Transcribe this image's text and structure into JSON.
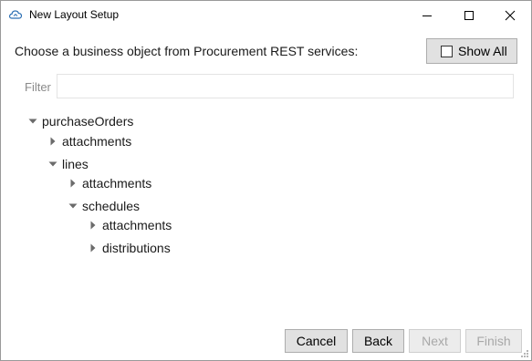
{
  "window": {
    "title": "New Layout Setup"
  },
  "prompt": "Choose a business object from Procurement REST services:",
  "show_all": {
    "label": "Show All",
    "checked": false
  },
  "filter": {
    "label": "Filter",
    "value": "",
    "placeholder": ""
  },
  "tree": [
    {
      "label": "purchaseOrders",
      "expanded": true
    },
    {
      "label": "attachments",
      "expanded": false
    },
    {
      "label": "lines",
      "expanded": true
    },
    {
      "label": "attachments",
      "expanded": false
    },
    {
      "label": "schedules",
      "expanded": true
    },
    {
      "label": "attachments",
      "expanded": false
    },
    {
      "label": "distributions",
      "expanded": false
    }
  ],
  "buttons": {
    "cancel": "Cancel",
    "back": "Back",
    "next": "Next",
    "finish": "Finish"
  },
  "icons": {
    "app": "cloud-icon",
    "minimize": "minimize-icon",
    "maximize": "maximize-icon",
    "close": "close-icon"
  }
}
